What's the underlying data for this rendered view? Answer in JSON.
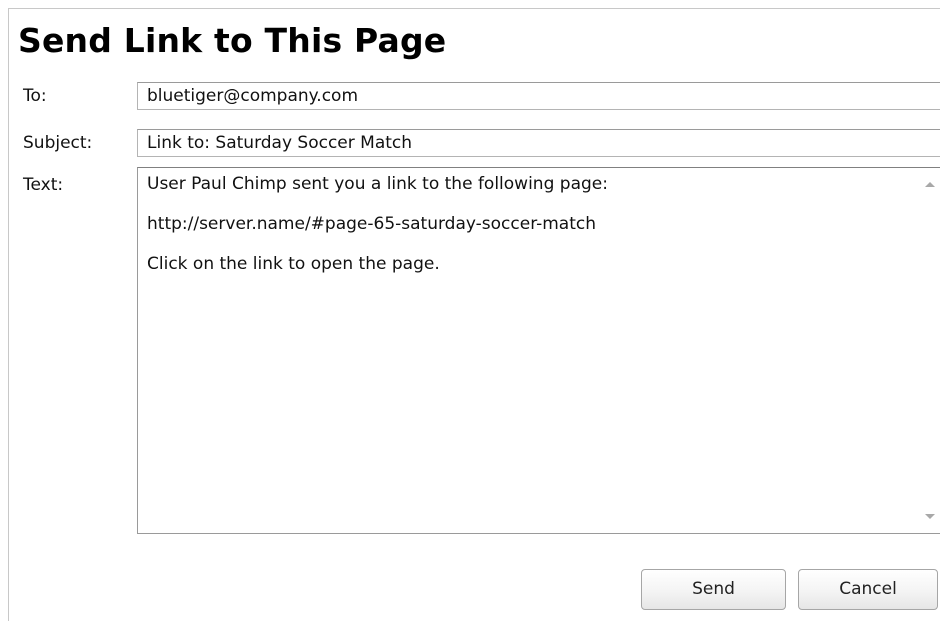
{
  "dialog": {
    "title": "Send Link to This Page"
  },
  "form": {
    "to": {
      "label": "To:",
      "value": "bluetiger@company.com"
    },
    "subject": {
      "label": "Subject:",
      "value": "Link to: Saturday Soccer Match"
    },
    "text": {
      "label": "Text:",
      "lines": [
        "User Paul Chimp sent you a link to the following page:",
        "http://server.name/#page-65-saturday-soccer-match",
        "Click on the link to open the page."
      ]
    }
  },
  "buttons": {
    "send_label": "Send",
    "cancel_label": "Cancel"
  },
  "icons": {
    "scroll_up": "scroll-up-arrow-icon",
    "scroll_down": "scroll-down-arrow-icon"
  }
}
